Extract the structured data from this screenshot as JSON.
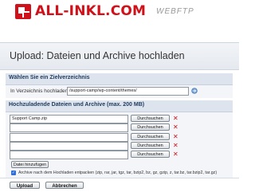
{
  "header": {
    "brand": "ALL-INKL.COM",
    "product": "WEBFTP",
    "brand_color": "#d0111a"
  },
  "page": {
    "title": "Upload: Dateien und Archive hochladen"
  },
  "target": {
    "heading": "Wählen Sie ein Zielverzeichnis",
    "label": "In Verzeichnis hochladen:",
    "path_value": "/support-camp/wp-content/themes/",
    "go_icon": "refresh-icon"
  },
  "files": {
    "heading": "Hochzuladende Dateien und Archive (max. 200 MB)",
    "rows": [
      {
        "value": "Support Camp.zip",
        "browse_label": "Durchsuchen"
      },
      {
        "value": "",
        "browse_label": "Durchsuchen"
      },
      {
        "value": "",
        "browse_label": "Durchsuchen"
      },
      {
        "value": "",
        "browse_label": "Durchsuchen"
      },
      {
        "value": "",
        "browse_label": "Durchsuchen"
      }
    ],
    "remove_icon": "close-icon",
    "add_label": "Datei hinzufügen",
    "extract_label": "Archive nach dem Hochladen entpacken (zip, rar, jar, tgz, tar, bzip2, bz, gz, gzip, z, tar.bz, tar.bzip2, tar.gz)",
    "extract_checked": true
  },
  "actions": {
    "upload_label": "Upload",
    "cancel_label": "Abbrechen"
  }
}
